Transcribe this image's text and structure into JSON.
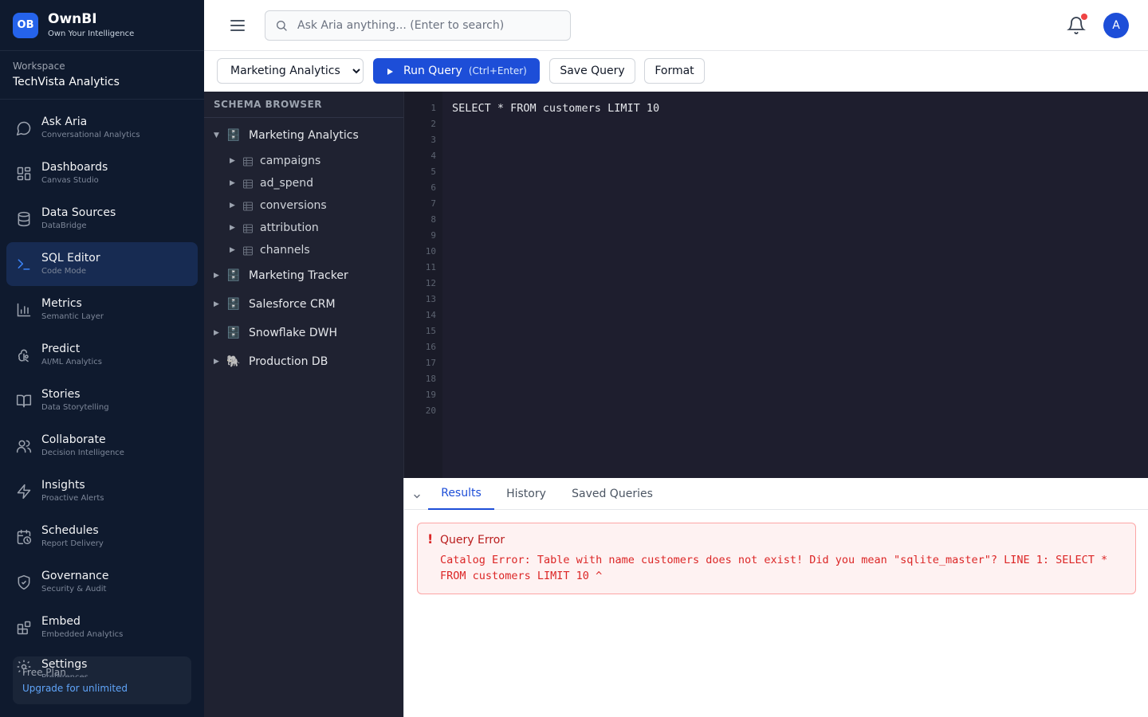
{
  "brand": {
    "logo": "OB",
    "name": "OwnBI",
    "tagline": "Own Your Intelligence"
  },
  "workspace": {
    "label": "Workspace",
    "name": "TechVista Analytics"
  },
  "nav": [
    {
      "label": "Ask Aria",
      "sub": "Conversational Analytics",
      "icon": "chat-icon"
    },
    {
      "label": "Dashboards",
      "sub": "Canvas Studio",
      "icon": "grid-icon"
    },
    {
      "label": "Data Sources",
      "sub": "DataBridge",
      "icon": "database-icon"
    },
    {
      "label": "SQL Editor",
      "sub": "Code Mode",
      "icon": "terminal-icon",
      "active": true
    },
    {
      "label": "Metrics",
      "sub": "Semantic Layer",
      "icon": "bar-chart-icon"
    },
    {
      "label": "Predict",
      "sub": "AI/ML Analytics",
      "icon": "brain-icon"
    },
    {
      "label": "Stories",
      "sub": "Data Storytelling",
      "icon": "book-icon"
    },
    {
      "label": "Collaborate",
      "sub": "Decision Intelligence",
      "icon": "users-icon"
    },
    {
      "label": "Insights",
      "sub": "Proactive Alerts",
      "icon": "zap-icon"
    },
    {
      "label": "Schedules",
      "sub": "Report Delivery",
      "icon": "calendar-clock-icon"
    },
    {
      "label": "Governance",
      "sub": "Security & Audit",
      "icon": "shield-icon"
    },
    {
      "label": "Embed",
      "sub": "Embedded Analytics",
      "icon": "blocks-icon"
    }
  ],
  "settings": {
    "label": "Settings",
    "sub": "Preferences"
  },
  "plan": {
    "title": "Free Plan",
    "link": "Upgrade for unlimited"
  },
  "header": {
    "search_placeholder": "Ask Aria anything... (Enter to search)",
    "avatar_initial": "A"
  },
  "toolbar": {
    "selected_db": "Marketing Analytics",
    "run_label": "Run Query",
    "run_shortcut": "(Ctrl+Enter)",
    "save_label": "Save Query",
    "format_label": "Format"
  },
  "schema": {
    "title": "SCHEMA BROWSER",
    "databases": [
      {
        "name": "Marketing Analytics",
        "expanded": true,
        "icon": "server-icon",
        "tables": [
          "campaigns",
          "ad_spend",
          "conversions",
          "attribution",
          "channels"
        ]
      },
      {
        "name": "Marketing Tracker",
        "expanded": false,
        "icon": "server-icon"
      },
      {
        "name": "Salesforce CRM",
        "expanded": false,
        "icon": "server-icon"
      },
      {
        "name": "Snowflake DWH",
        "expanded": false,
        "icon": "server-icon"
      },
      {
        "name": "Production DB",
        "expanded": false,
        "icon": "postgres-elephant-icon"
      }
    ]
  },
  "editor": {
    "code": "SELECT * FROM customers LIMIT 10",
    "line_numbers": [
      "1",
      "2",
      "3",
      "4",
      "5",
      "6",
      "7",
      "8",
      "9",
      "10",
      "11",
      "12",
      "13",
      "14",
      "15",
      "16",
      "17",
      "18",
      "19",
      "20"
    ]
  },
  "results": {
    "tabs": [
      "Results",
      "History",
      "Saved Queries"
    ],
    "active_tab": "Results",
    "error": {
      "mark": "!",
      "title": "Query Error",
      "message": "Catalog Error: Table with name customers does not exist! Did you mean \"sqlite_master\"? LINE 1: SELECT * FROM customers LIMIT 10 ^"
    }
  }
}
